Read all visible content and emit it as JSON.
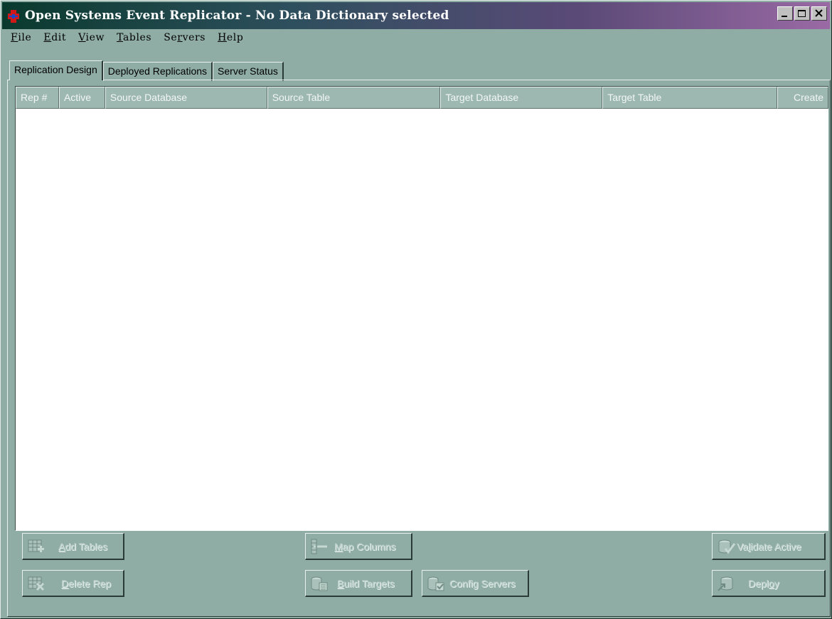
{
  "window": {
    "title": "Open Systems Event Replicator - No Data Dictionary selected"
  },
  "menu": {
    "items": [
      {
        "label": "File",
        "key": "F"
      },
      {
        "label": "Edit",
        "key": "E"
      },
      {
        "label": "View",
        "key": "V"
      },
      {
        "label": "Tables",
        "key": "T"
      },
      {
        "label": "Servers",
        "key": "r"
      },
      {
        "label": "Help",
        "key": "H"
      }
    ]
  },
  "tabs": [
    {
      "label": "Replication Design",
      "active": true
    },
    {
      "label": "Deployed Replications",
      "active": false
    },
    {
      "label": "Server Status",
      "active": false
    }
  ],
  "grid": {
    "columns": [
      "Rep #",
      "Active",
      "Source Database",
      "Source Table",
      "Target Database",
      "Target Table",
      "Create"
    ],
    "rows": []
  },
  "buttons": {
    "add_tables": {
      "pre": "",
      "key": "A",
      "post": "dd Tables",
      "enabled": false,
      "icon": "add-table-icon"
    },
    "delete_rep": {
      "pre": "",
      "key": "D",
      "post": "elete Rep",
      "enabled": false,
      "icon": "delete-table-icon"
    },
    "map_columns": {
      "pre": "",
      "key": "M",
      "post": "ap Columns",
      "enabled": false,
      "icon": "map-columns-icon"
    },
    "build_targets": {
      "pre": "",
      "key": "B",
      "post": "uild Targets",
      "enabled": false,
      "icon": "build-targets-icon"
    },
    "config_servers": {
      "pre": "Confi",
      "key": "g",
      "post": " Servers",
      "enabled": false,
      "icon": "config-servers-icon"
    },
    "validate_active": {
      "pre": "Va",
      "key": "l",
      "post": "idate Active",
      "enabled": false,
      "icon": "validate-icon"
    },
    "deploy": {
      "pre": "Depl",
      "key": "o",
      "post": "y",
      "enabled": false,
      "icon": "deploy-icon"
    }
  },
  "colors": {
    "window_bg": "#8fada4",
    "title_gradient_start": "#0a3a2e",
    "title_gradient_end": "#9a6aa4",
    "disabled_text": "#bcd0ca"
  }
}
